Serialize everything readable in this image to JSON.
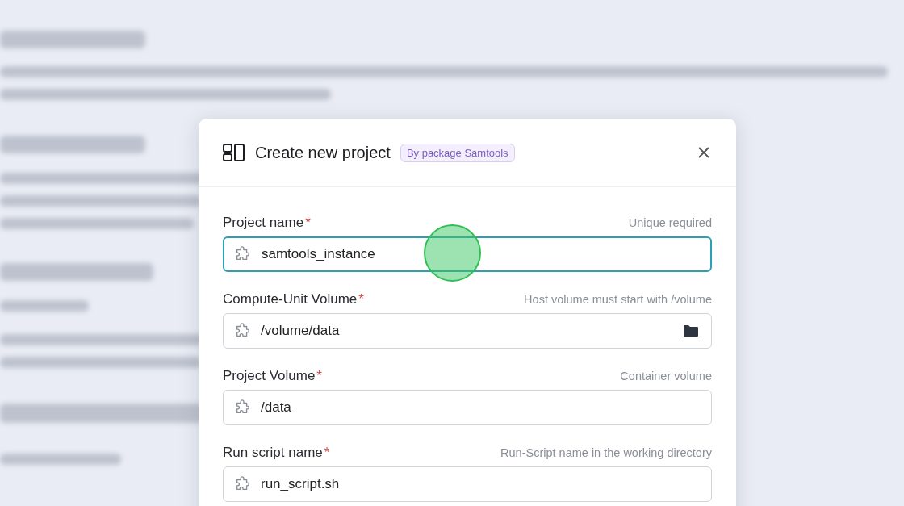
{
  "dialog": {
    "title": "Create new project",
    "badge": "By package Samtools"
  },
  "fields": [
    {
      "label": "Project name",
      "required_mark": "*",
      "hint": "Unique required",
      "value": "samtools_instance",
      "focused": true,
      "kind": "text"
    },
    {
      "label": "Compute-Unit Volume",
      "required_mark": "*",
      "hint": "Host volume must start with /volume",
      "value": "/volume/data",
      "focused": false,
      "kind": "folder"
    },
    {
      "label": "Project Volume",
      "required_mark": "*",
      "hint": "Container volume",
      "value": "/data",
      "focused": false,
      "kind": "text"
    },
    {
      "label": "Run script name",
      "required_mark": "*",
      "hint": "Run-Script name in the working directory",
      "value": "run_script.sh",
      "focused": false,
      "kind": "text"
    }
  ]
}
